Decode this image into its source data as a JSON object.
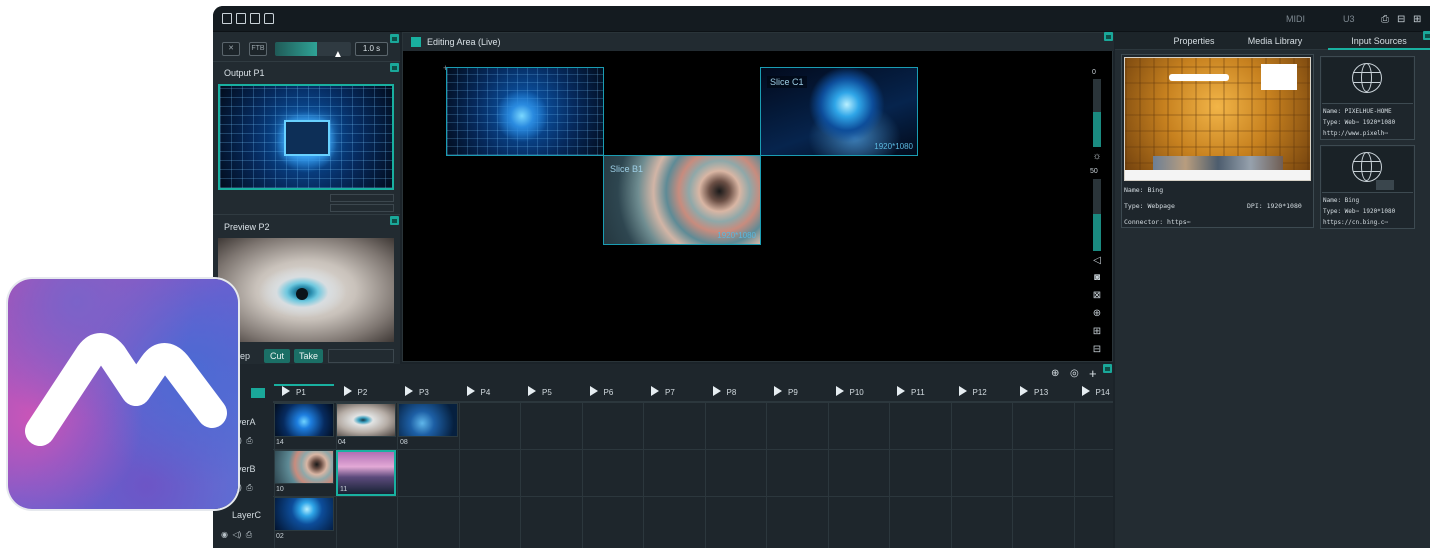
{
  "topbar": {
    "icons": [
      "new-file-icon",
      "open-file-icon",
      "save-icon",
      "export-icon"
    ],
    "midi_label": "MIDI",
    "u3_label": "U3",
    "right_icons": [
      "layout-icon-1",
      "layout-icon-2",
      "layout-icon-3"
    ]
  },
  "transition": {
    "close_label": "✕",
    "ftb_label": "FTB",
    "progress": 0.55,
    "duration": "1.0 s"
  },
  "output": {
    "label": "Output",
    "page": "P1"
  },
  "preview": {
    "label": "Preview",
    "page": "P2"
  },
  "controls": {
    "sweep_label": "eep",
    "cut_label": "Cut",
    "take_label": "Take"
  },
  "editing": {
    "title": "Editing Area (Live)",
    "slices": [
      {
        "label": "",
        "res": ""
      },
      {
        "label": "Slice C1",
        "res": "1920*1080"
      },
      {
        "label": "Slice B1",
        "res": "1920*1080"
      }
    ],
    "vu_top_value": "0",
    "vu_mid_value": "50",
    "side_icons": [
      "screenshot-icon",
      "cross-box-icon",
      "target-icon",
      "plus-box-icon",
      "minus-box-icon"
    ]
  },
  "timeline": {
    "pages": [
      "P1",
      "P2",
      "P3",
      "P4",
      "P5",
      "P6",
      "P7",
      "P8",
      "P9",
      "P10",
      "P11",
      "P12",
      "P13",
      "P14"
    ],
    "layers": [
      {
        "name": "LayerA",
        "display": "ayerA",
        "clips": [
          "14",
          "04",
          "08"
        ]
      },
      {
        "name": "LayerB",
        "display": "ayerB",
        "clips": [
          "10",
          "11"
        ]
      },
      {
        "name": "LayerC",
        "display": "LayerC",
        "clips": [
          "02"
        ]
      }
    ],
    "toolbar_icons": [
      "crosshair-icon",
      "location-icon",
      "add-icon"
    ]
  },
  "right_panel": {
    "tabs": [
      "Properties",
      "Media Library",
      "Input Sources"
    ],
    "active_tab": "Input Sources",
    "main_source": {
      "name": "Name:  Bing",
      "type": "Type:  Webpage",
      "dpi": "DPI: 1920*1080",
      "connector": "Connector: https⋯"
    },
    "card1": {
      "name": "Name:  PIXELHUE-HOME",
      "type": "Type:  Web⋯ 1920*1080",
      "url": "http://www.pixelh⋯"
    },
    "card2": {
      "name": "Name:  Bing",
      "type": "Type:  Web⋯ 1920*1080",
      "url": "https://cn.bing.c⋯"
    }
  },
  "colors": {
    "accent": "#1aa89a",
    "background": "#1b2329",
    "slice_border": "#1a9db3"
  }
}
